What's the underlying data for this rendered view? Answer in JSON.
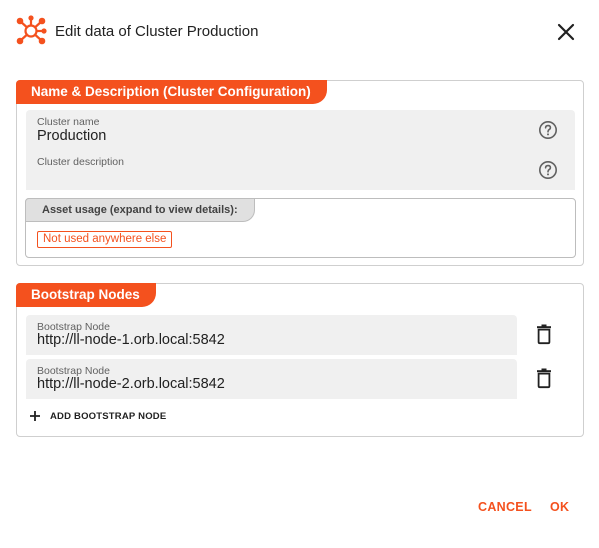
{
  "dialog": {
    "title": "Edit data of Cluster Production",
    "logo_icon": "cluster-network-icon",
    "close_icon": "close-icon"
  },
  "config_section": {
    "tab_label": "Name & Description (Cluster Configuration)",
    "name_field": {
      "label": "Cluster name",
      "value": "Production"
    },
    "description_field": {
      "label": "Cluster description",
      "value": ""
    },
    "help_icon": "help-circle-icon",
    "asset_usage": {
      "tab_label": "Asset usage (expand to view details):",
      "chip": "Not used anywhere else"
    }
  },
  "bootstrap_section": {
    "tab_label": "Bootstrap Nodes",
    "nodes": [
      {
        "label": "Bootstrap Node",
        "value": "http://ll-node-1.orb.local:5842"
      },
      {
        "label": "Bootstrap Node",
        "value": "http://ll-node-2.orb.local:5842"
      }
    ],
    "delete_icon": "trash-icon",
    "add_label": "ADD BOOTSTRAP NODE"
  },
  "actions": {
    "cancel_label": "CANCEL",
    "ok_label": "OK"
  },
  "colors": {
    "accent": "#f4511e",
    "field_bg": "#f0f0f0",
    "border": "#cfcfcf"
  }
}
